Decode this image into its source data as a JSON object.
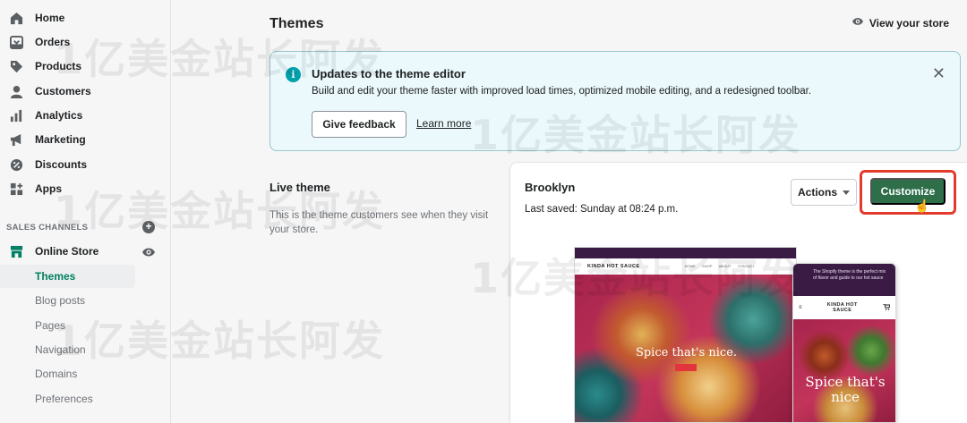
{
  "sidebar": {
    "items": [
      {
        "label": "Home",
        "icon": "home-icon"
      },
      {
        "label": "Orders",
        "icon": "orders-icon"
      },
      {
        "label": "Products",
        "icon": "tag-icon"
      },
      {
        "label": "Customers",
        "icon": "person-icon"
      },
      {
        "label": "Analytics",
        "icon": "bar-chart-icon"
      },
      {
        "label": "Marketing",
        "icon": "megaphone-icon"
      },
      {
        "label": "Discounts",
        "icon": "discount-icon"
      },
      {
        "label": "Apps",
        "icon": "apps-icon"
      }
    ],
    "channels_heading": "SALES CHANNELS",
    "online_store": "Online Store",
    "sub_items": [
      "Themes",
      "Blog posts",
      "Pages",
      "Navigation",
      "Domains",
      "Preferences"
    ]
  },
  "header": {
    "title": "Themes",
    "view_store": "View your store"
  },
  "banner": {
    "title": "Updates to the theme editor",
    "body": "Build and edit your theme faster with improved load times, optimized mobile editing, and a redesigned toolbar.",
    "feedback_label": "Give feedback",
    "learn_label": "Learn more"
  },
  "live_theme": {
    "heading": "Live theme",
    "description": "This is the theme customers see when they visit your store."
  },
  "theme_card": {
    "name": "Brooklyn",
    "last_saved": "Last saved: Sunday at 08:24 p.m.",
    "actions_label": "Actions",
    "customize_label": "Customize"
  },
  "preview": {
    "desktop_logo": "KINDA HOT SAUCE",
    "desktop_menu": [
      "HOME",
      "SHOP",
      "ABOUT",
      "CONTACT"
    ],
    "desktop_headline": "Spice that's nice.",
    "mobile_logo_line1": "KINDA HOT",
    "mobile_logo_line2": "SAUCE",
    "mobile_promo": "The Shopify theme is the perfect mix of flavor and guide to our hot sauce",
    "mobile_headline": "Spice that's nice"
  },
  "watermark": "1亿美金站长阿发",
  "colors": {
    "accent_green": "#2e6f4a",
    "active_text": "#008060",
    "banner_bg": "#ebf9fc",
    "highlight_ring": "#e23b2d"
  }
}
